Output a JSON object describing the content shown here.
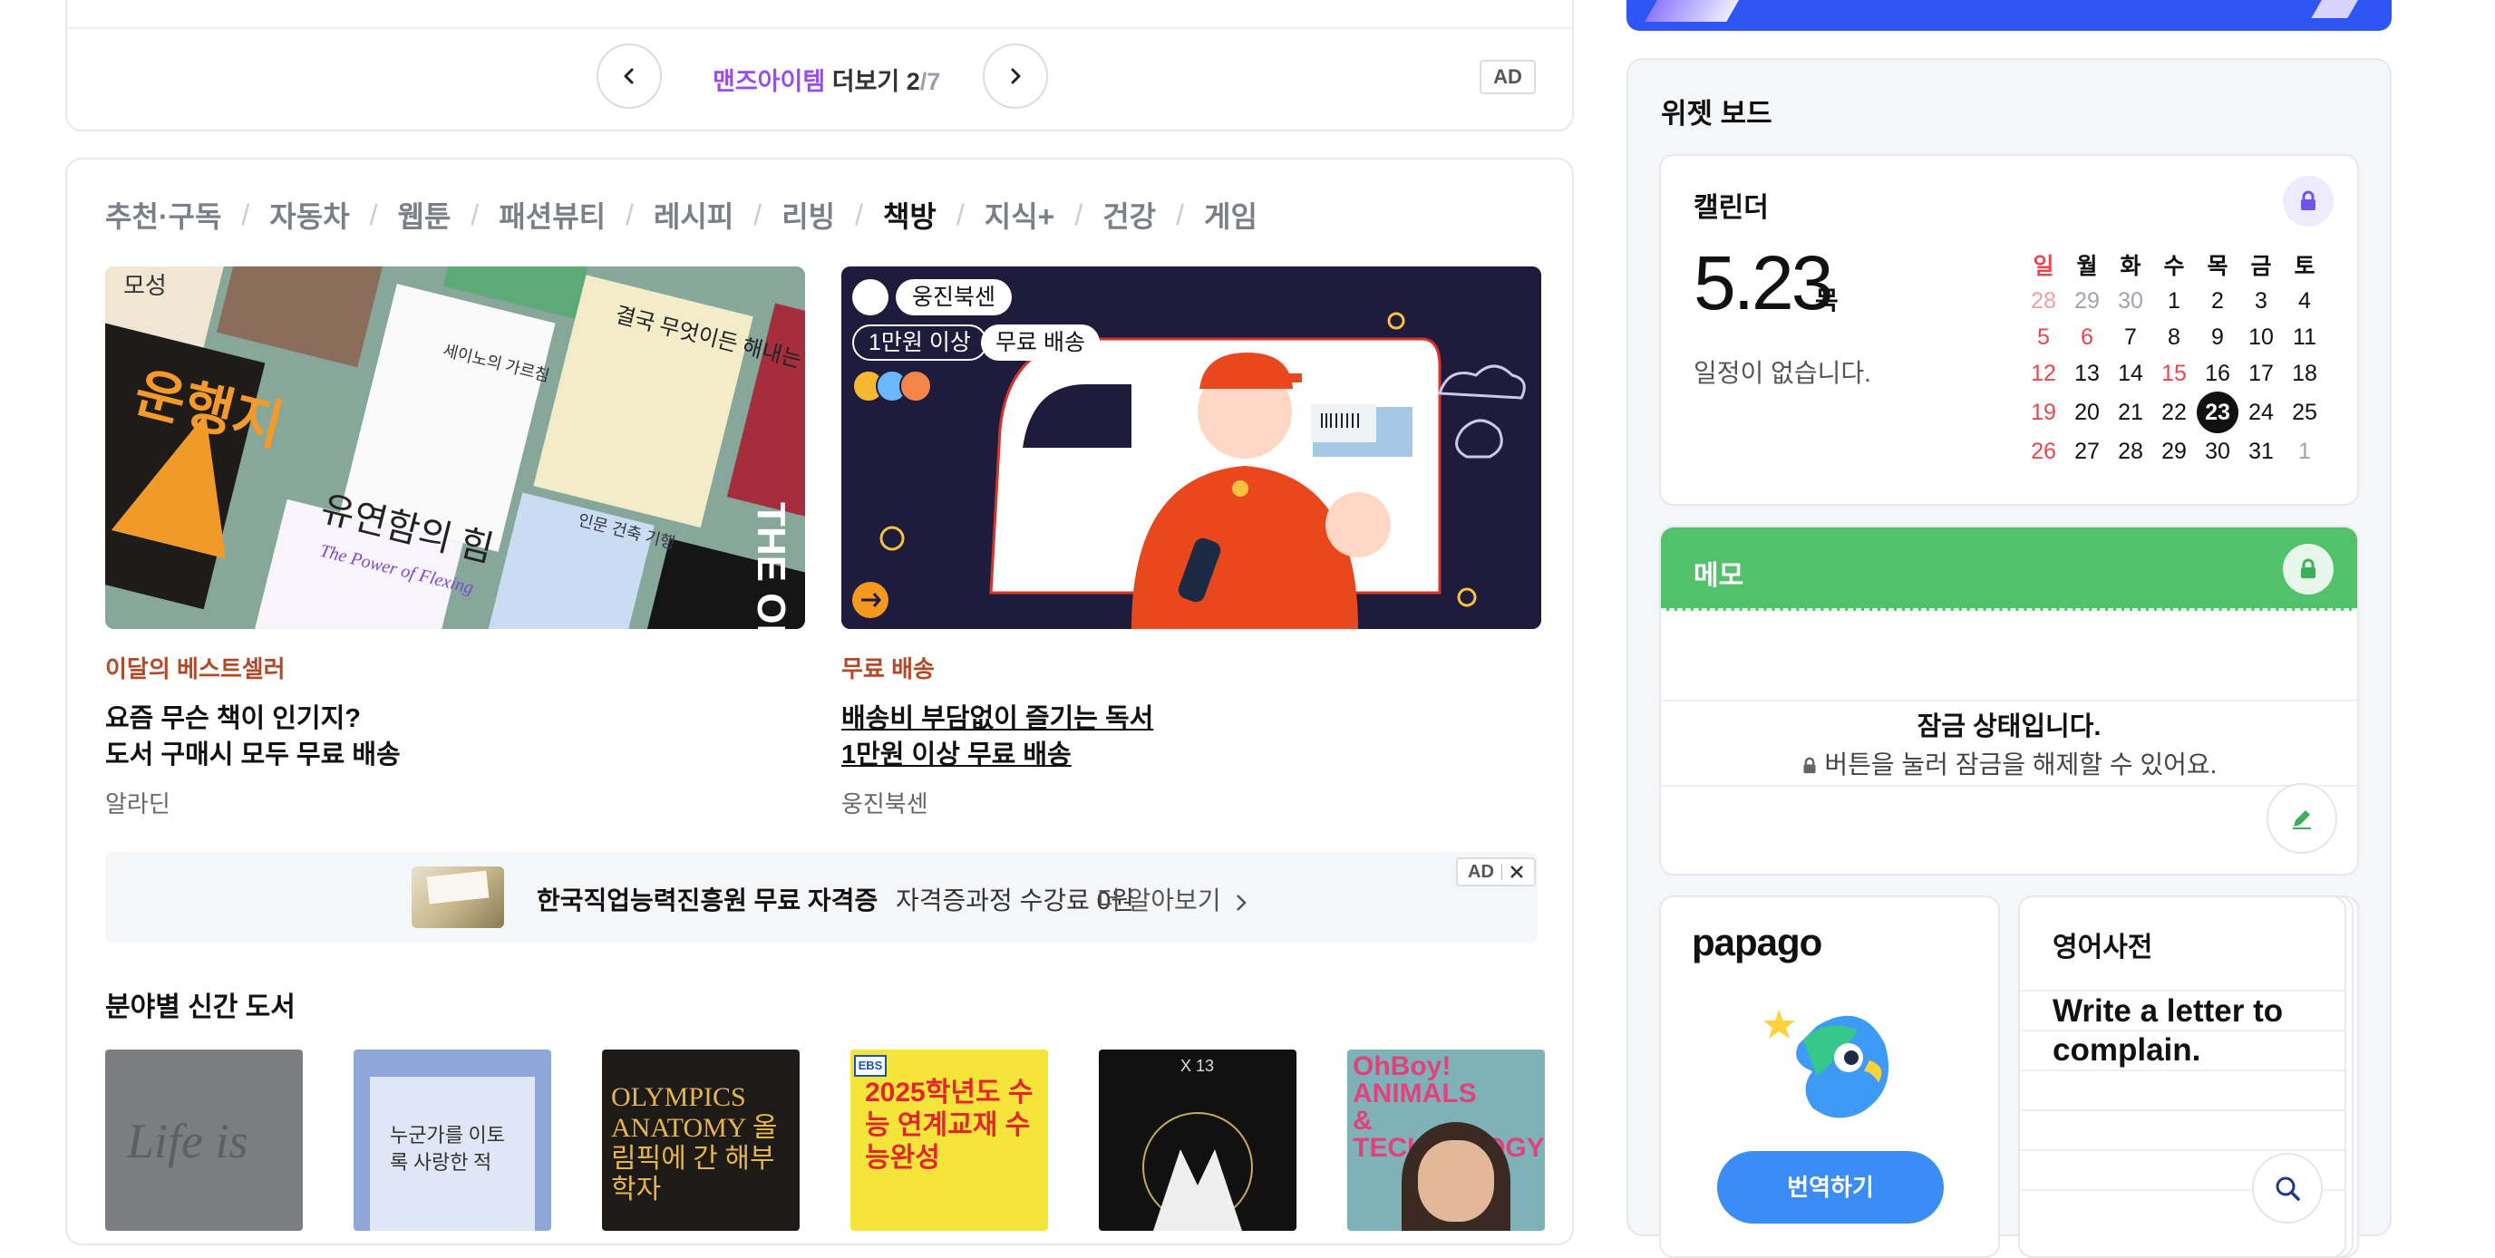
{
  "pager": {
    "accent": "맨즈아이템",
    "rest": " 더보기 ",
    "current": "2",
    "total": "/7",
    "ad": "AD"
  },
  "categories": [
    "추천·구독",
    "자동차",
    "웹툰",
    "패션뷰티",
    "레시피",
    "리빙",
    "책방",
    "지식+",
    "건강",
    "게임"
  ],
  "active_category": "책방",
  "cards": [
    {
      "category": "이달의 베스트셀러",
      "title1": "요즘 무슨 책이 인기지?",
      "title2": "도서 구매시 모두 무료 배송",
      "source": "알라딘",
      "cover_words": {
        "a": "모성",
        "b": "운행지",
        "c": "세이노의 가르침",
        "d": "결국 무엇이든 해내는 사람",
        "e": "유연함의 힘",
        "f": "The Power of Flexing",
        "g": "인문 건축 기행",
        "h": "THE ONE"
      }
    },
    {
      "category": "무료 배송",
      "title1": "배송비 부담없이 즐기는 독서",
      "title2": "1만원 이상 무료 배송",
      "source": "웅진북센",
      "badge": "웅진북센",
      "chip1": "1만원 이상",
      "chip2": "무료 배송"
    }
  ],
  "ad_bar": {
    "title": "한국직업능력진흥원 무료 자격증",
    "desc": "자격증과정 수강료 0원",
    "more": "더 알아보기",
    "ad": "AD"
  },
  "new_books": {
    "title": "분야별 신간 도서",
    "covers": [
      {
        "text": "Life is",
        "bg": "#7b7d80"
      },
      {
        "text": "누군가를 이토록 사랑한 적",
        "bg": "#8fa6d8"
      },
      {
        "text": "OLYMPICS ANATOMY 올림픽에 간 해부학자",
        "bg": "#1d1a17"
      },
      {
        "text": "2025학년도 수능 연계교재 수능완성",
        "bg": "#f5e43a"
      },
      {
        "text": "X 13",
        "bg": "#111111"
      },
      {
        "text": "OhBoy! ANIMALS & TECHNOLOGY",
        "bg": "#7fb2b8"
      }
    ]
  },
  "widget": {
    "title": "위젯 보드",
    "calendar": {
      "title": "캘린더",
      "date": "5.23",
      "dow": "목",
      "empty": "일정이 없습니다.",
      "weekdays": [
        "일",
        "월",
        "화",
        "수",
        "목",
        "금",
        "토"
      ],
      "weeks": [
        [
          "28",
          "29",
          "30",
          "1",
          "2",
          "3",
          "4"
        ],
        [
          "5",
          "6",
          "7",
          "8",
          "9",
          "10",
          "11"
        ],
        [
          "12",
          "13",
          "14",
          "15",
          "16",
          "17",
          "18"
        ],
        [
          "19",
          "20",
          "21",
          "22",
          "23",
          "24",
          "25"
        ],
        [
          "26",
          "27",
          "28",
          "29",
          "30",
          "31",
          "1"
        ]
      ],
      "today": "23"
    },
    "memo": {
      "title": "메모",
      "locked": "잠금 상태입니다.",
      "hint": "버튼을 눌러 잠금을 해제할 수 있어요."
    },
    "papago": {
      "logo": "papago",
      "button": "번역하기"
    },
    "dictionary": {
      "title": "영어사전",
      "phrase": "Write a letter to complain."
    }
  },
  "colors": {
    "accent_purple": "#9a4cf0",
    "memo_green": "#52c26a",
    "papago_blue": "#3b8cf4",
    "sunday_red": "#e5484d",
    "bestseller_brown": "#b24a2a"
  }
}
